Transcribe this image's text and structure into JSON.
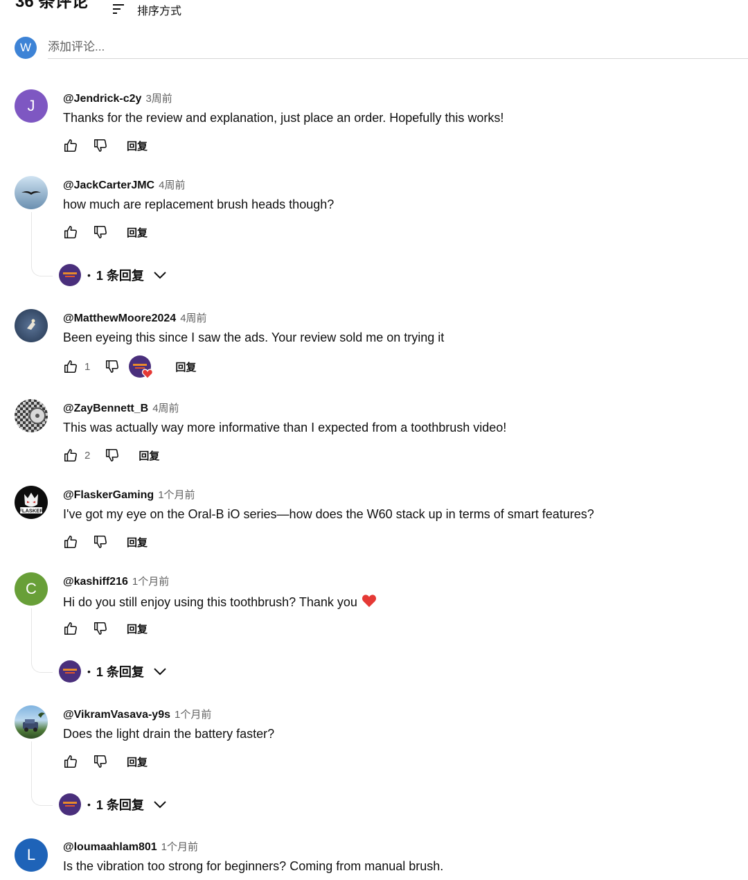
{
  "header": {
    "count": "36 条评论",
    "sort_label": "排序方式"
  },
  "add_comment": {
    "avatar_letter": "W",
    "placeholder": "添加评论..."
  },
  "reply_label": "回复",
  "comments": [
    {
      "author": "@Jendrick-c2y",
      "time": "3周前",
      "text": "Thanks for the review and explanation, just place an order. Hopefully this works!",
      "avatar_letter": "J",
      "avatar_color": "#7e57c2"
    },
    {
      "author": "@JackCarterJMC",
      "time": "4周前",
      "text": "how much are replacement brush heads though?",
      "replies": "1 条回复"
    },
    {
      "author": "@MatthewMoore2024",
      "time": "4周前",
      "text": "Been eyeing this since I saw the ads. Your review sold me on trying it",
      "likes": "1"
    },
    {
      "author": "@ZayBennett_B",
      "time": "4周前",
      "text": "This was actually way more informative than I expected from a toothbrush video!",
      "likes": "2"
    },
    {
      "author": "@FlaskerGaming",
      "time": "1个月前",
      "text": "I've got my eye on the Oral-B iO series—how does the W60 stack up in terms of smart features?"
    },
    {
      "author": "@kashiff216",
      "time": "1个月前",
      "text": "Hi do you still enjoy using this toothbrush? Thank you",
      "avatar_letter": "C",
      "avatar_color": "#689f38",
      "replies": "1 条回复"
    },
    {
      "author": "@VikramVasava-y9s",
      "time": "1个月前",
      "text": "Does the light drain the battery faster?",
      "replies": "1 条回复"
    },
    {
      "author": "@loumaahlam801",
      "time": "1个月前",
      "text": "Is the vibration too strong for beginners? Coming from manual brush.",
      "avatar_letter": "L",
      "avatar_color": "#1e63b8"
    }
  ],
  "colors": {
    "accent": "#3d83d6",
    "heart": "#e53935",
    "secondary_text": "#606060"
  }
}
